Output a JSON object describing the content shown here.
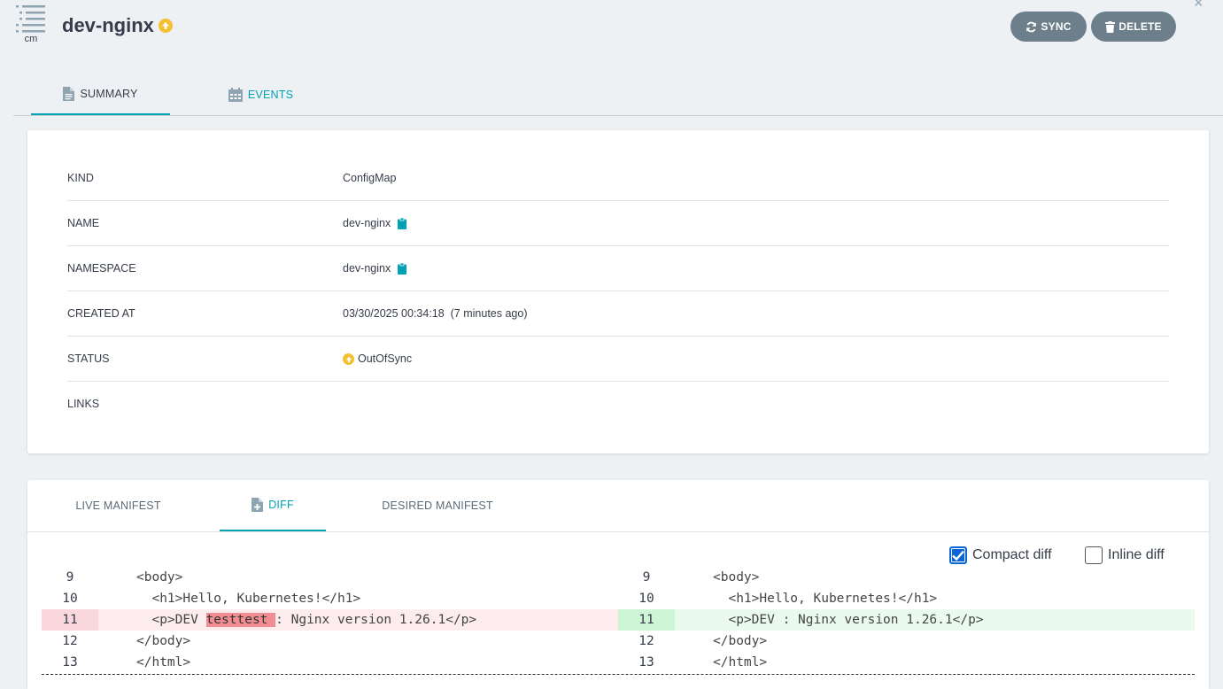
{
  "header": {
    "kind_label": "cm",
    "title": "dev-nginx",
    "sync_label": "SYNC",
    "delete_label": "DELETE",
    "close_symbol": "×"
  },
  "tabs": {
    "summary": "SUMMARY",
    "events": "EVENTS"
  },
  "summary": {
    "rows": [
      {
        "key": "KIND",
        "value": "ConfigMap"
      },
      {
        "key": "NAME",
        "value": "dev-nginx"
      },
      {
        "key": "NAMESPACE",
        "value": "dev-nginx"
      },
      {
        "key": "CREATED AT",
        "value": "03/30/2025 00:34:18  (7 minutes ago)"
      },
      {
        "key": "STATUS",
        "value": "OutOfSync"
      },
      {
        "key": "LINKS",
        "value": ""
      }
    ]
  },
  "manifest_tabs": {
    "live": "LIVE MANIFEST",
    "diff": "DIFF",
    "desired": "DESIRED MANIFEST"
  },
  "options": {
    "compact_label": "Compact diff",
    "compact_checked": true,
    "inline_label": "Inline diff",
    "inline_checked": false
  },
  "diff": {
    "left": [
      {
        "num": "9",
        "code": "<body>",
        "type": "normal"
      },
      {
        "num": "10",
        "code": "  <h1>Hello, Kubernetes!</h1>",
        "type": "normal"
      },
      {
        "num": "11",
        "code_pre": "  <p>DEV ",
        "code_hl": "testtest ",
        "code_post": ": Nginx version 1.26.1</p>",
        "type": "deleted"
      },
      {
        "num": "12",
        "code": "</body>",
        "type": "normal"
      },
      {
        "num": "13",
        "code": "</html>",
        "type": "normal"
      }
    ],
    "right": [
      {
        "num": "9",
        "code": "<body>",
        "type": "normal"
      },
      {
        "num": "10",
        "code": "  <h1>Hello, Kubernetes!</h1>",
        "type": "normal"
      },
      {
        "num": "11",
        "code": "  <p>DEV : Nginx version 1.26.1</p>",
        "type": "added"
      },
      {
        "num": "12",
        "code": "</body>",
        "type": "normal"
      },
      {
        "num": "13",
        "code": "</html>",
        "type": "normal"
      }
    ]
  },
  "colors": {
    "accent": "#00a2b3",
    "button": "#6d7f8b",
    "warning": "#f4c030",
    "deleted": "#fdeced",
    "added": "#eafbee"
  },
  "icons": {
    "kind": "list-icon",
    "status": "arrow-up-circle-icon",
    "sync": "refresh-icon",
    "delete": "trash-icon",
    "summary_tab": "file-icon",
    "events_tab": "calendar-icon",
    "diff_tab": "file-plus-icon",
    "copy": "clipboard-icon"
  }
}
